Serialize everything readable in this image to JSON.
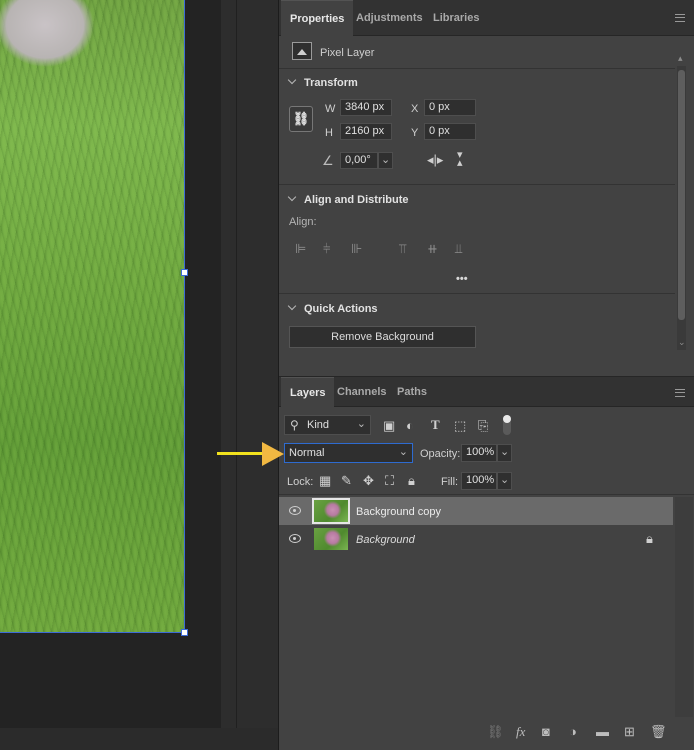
{
  "properties_panel": {
    "tabs": [
      "Properties",
      "Adjustments",
      "Libraries"
    ],
    "active_tab": "Properties",
    "layer_kind": "Pixel Layer",
    "transform": {
      "title": "Transform",
      "w_label": "W",
      "w_value": "3840 px",
      "h_label": "H",
      "h_value": "2160 px",
      "x_label": "X",
      "x_value": "0 px",
      "y_label": "Y",
      "y_value": "0 px",
      "angle_value": "0,00°"
    },
    "align": {
      "title": "Align and Distribute",
      "align_label": "Align:",
      "more": "•••"
    },
    "quick_actions": {
      "title": "Quick Actions",
      "remove_bg": "Remove Background"
    }
  },
  "layers_panel": {
    "tabs": [
      "Layers",
      "Channels",
      "Paths"
    ],
    "active_tab": "Layers",
    "filter_kind": "Kind",
    "blend_mode": "Normal",
    "opacity_label": "Opacity:",
    "opacity_value": "100%",
    "lock_label": "Lock:",
    "fill_label": "Fill:",
    "fill_value": "100%",
    "layers": [
      {
        "name": "Background copy",
        "selected": true,
        "locked": false
      },
      {
        "name": "Background",
        "selected": false,
        "locked": true
      }
    ],
    "footer": {
      "fx": "fx"
    }
  },
  "annotation": {
    "arrow_color": "#f2e21e"
  },
  "colors": {
    "selection_blue": "#3c6bd6",
    "panel_bg": "#424242"
  }
}
